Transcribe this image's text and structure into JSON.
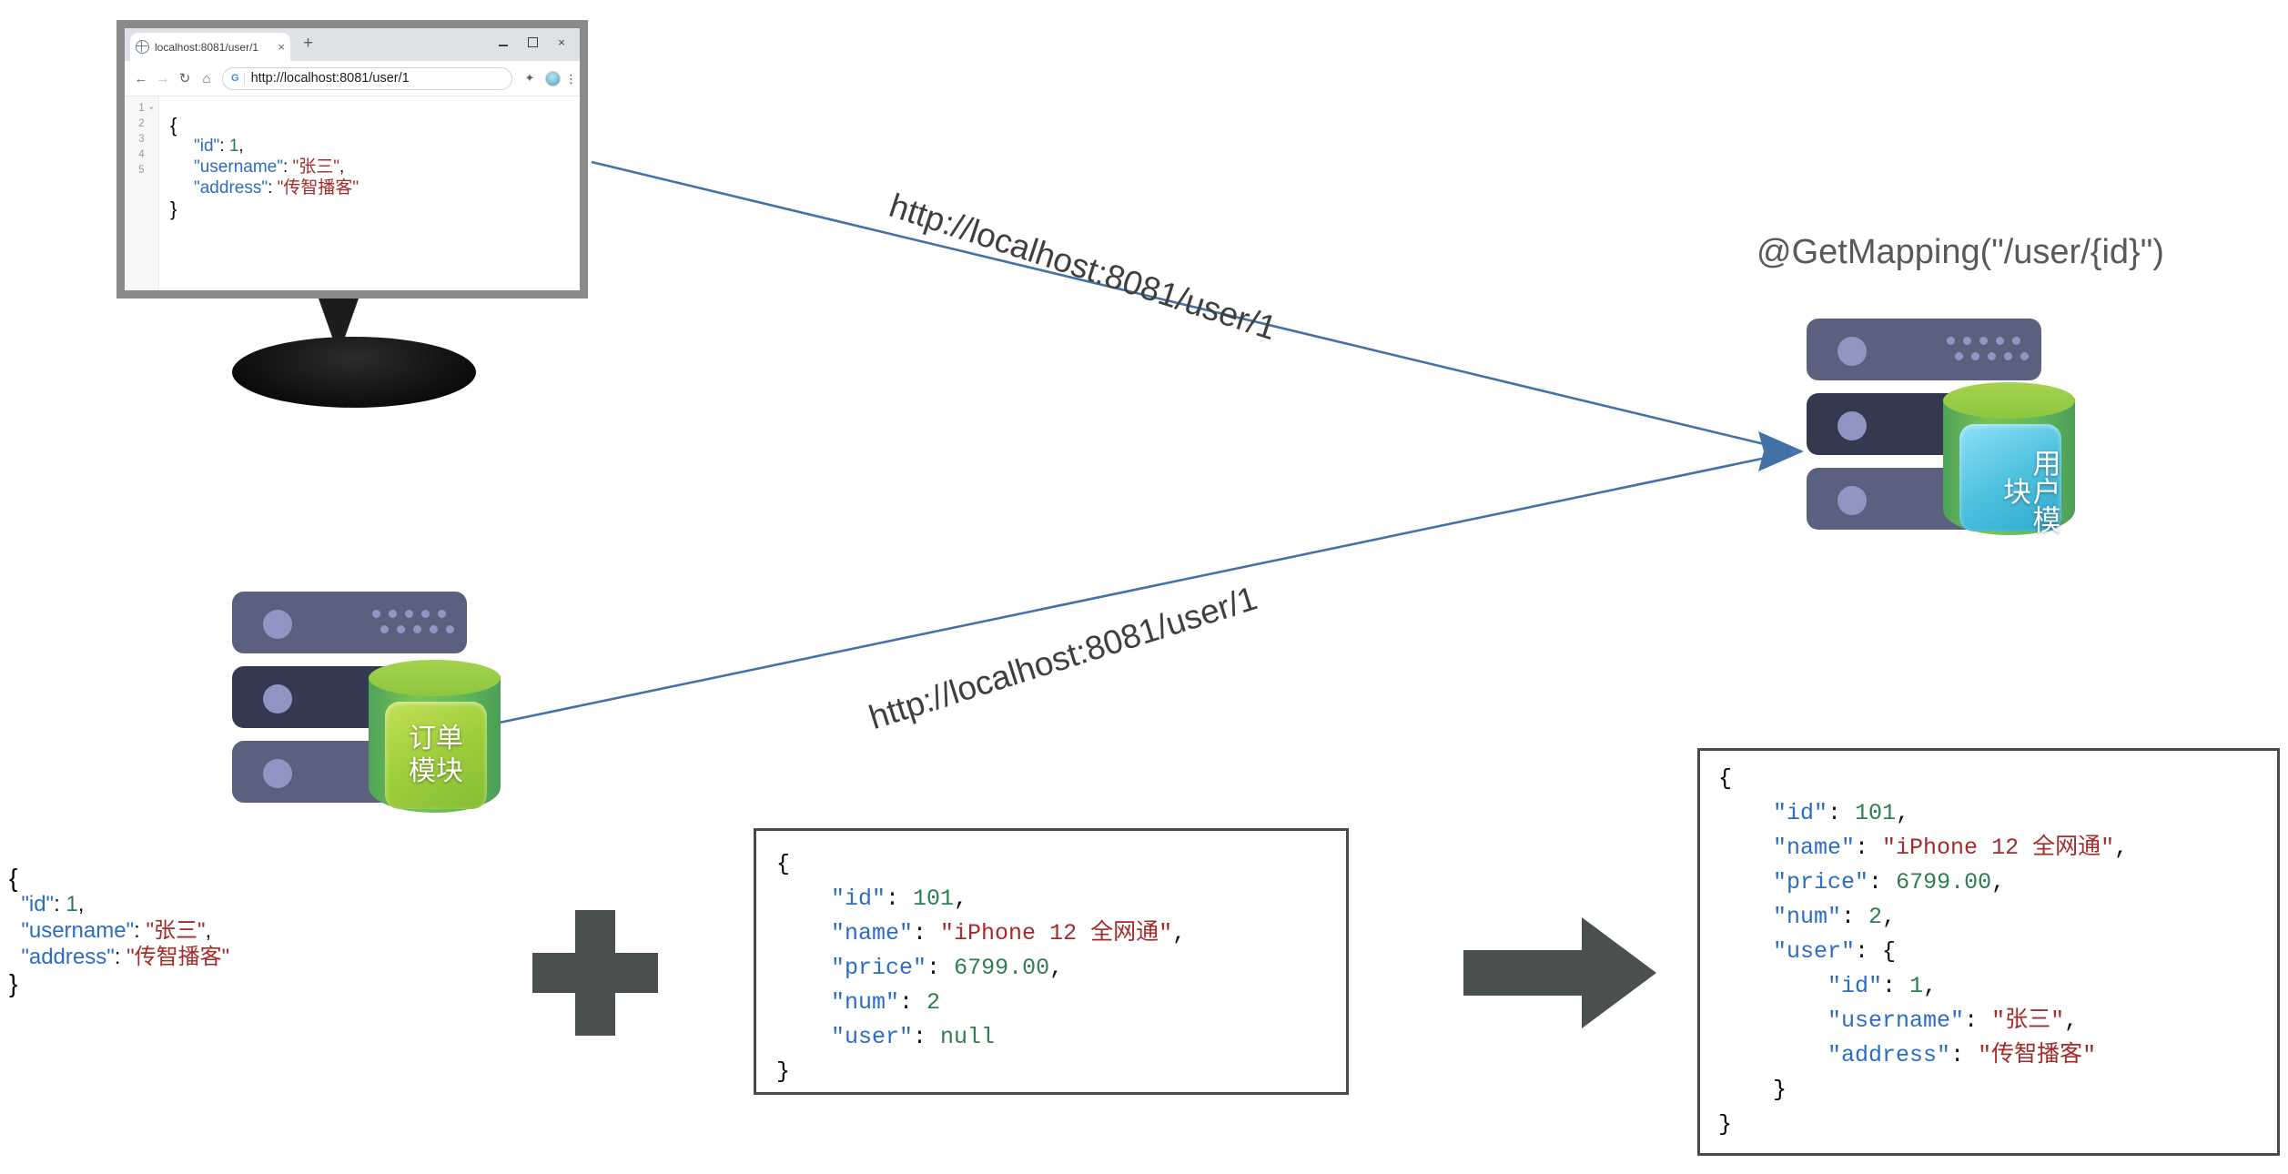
{
  "browser": {
    "tab_title": "localhost:8081/user/1",
    "tab_close": "×",
    "new_tab": "+",
    "window_minimize": "",
    "window_maximize": "",
    "window_close": "×",
    "nav_back": "←",
    "nav_forward": "→",
    "nav_reload": "↻",
    "nav_home": "⌂",
    "search_engine_icon": "G",
    "url": "http://localhost:8081/user/1",
    "extensions_icon": "✦",
    "menu_icon": "⋮",
    "gutter_lines": [
      "1",
      "2",
      "3",
      "4",
      "5"
    ],
    "gutter_caret": "▾",
    "response": {
      "open_brace": "{",
      "close_brace": "}",
      "rows": [
        {
          "key": "\"id\"",
          "sep": ": ",
          "value": "1",
          "type": "num",
          "comma": ","
        },
        {
          "key": "\"username\"",
          "sep": ": ",
          "value": "\"张三\"",
          "type": "str",
          "comma": ","
        },
        {
          "key": "\"address\"",
          "sep": ": ",
          "value": "\"传智播客\"",
          "type": "str",
          "comma": ""
        }
      ]
    }
  },
  "servers": {
    "order": {
      "label_lines": [
        "订单",
        "模块"
      ],
      "name": "order-module"
    },
    "user": {
      "label_lines": [
        "用户模块"
      ],
      "name": "user-module"
    }
  },
  "labels": {
    "url_top": "http://localhost:8081/user/1",
    "url_bottom": "http://localhost:8081/user/1",
    "get_mapping": "@GetMapping(\"/user/{id}\")"
  },
  "json_left": {
    "open": "{",
    "close": "}",
    "rows": [
      {
        "key": "\"id\"",
        "sep": ": ",
        "value": "1",
        "type": "num",
        "comma": ","
      },
      {
        "key": "\"username\"",
        "sep": ": ",
        "value": "\"张三\"",
        "type": "str",
        "comma": ","
      },
      {
        "key": "\"address\"",
        "sep": ": ",
        "value": "\"传智播客\"",
        "type": "str",
        "comma": ""
      }
    ]
  },
  "json_mid": {
    "open": "{",
    "close": "}",
    "rows": [
      {
        "key": "\"id\"",
        "sep": ": ",
        "value": "101",
        "type": "num",
        "comma": ","
      },
      {
        "key": "\"name\"",
        "sep": ": ",
        "value": "\"iPhone 12 全网通\"",
        "type": "str",
        "comma": ","
      },
      {
        "key": "\"price\"",
        "sep": ": ",
        "value": "6799.00",
        "type": "num",
        "comma": ","
      },
      {
        "key": "\"num\"",
        "sep": ": ",
        "value": "2",
        "type": "num",
        "comma": ""
      },
      {
        "key": "\"user\"",
        "sep": ": ",
        "value": "null",
        "type": "num",
        "comma": ""
      }
    ]
  },
  "json_right": {
    "open": "{",
    "close": "}",
    "rows": [
      {
        "key": "\"id\"",
        "sep": ": ",
        "value": "101",
        "type": "num",
        "comma": ",",
        "indent": 1
      },
      {
        "key": "\"name\"",
        "sep": ": ",
        "value": "\"iPhone 12 全网通\"",
        "type": "str",
        "comma": ",",
        "indent": 1
      },
      {
        "key": "\"price\"",
        "sep": ": ",
        "value": "6799.00",
        "type": "num",
        "comma": ",",
        "indent": 1
      },
      {
        "key": "\"num\"",
        "sep": ": ",
        "value": "2",
        "type": "num",
        "comma": ",",
        "indent": 1
      },
      {
        "key": "\"user\"",
        "sep": ": ",
        "value": "{",
        "type": "plain",
        "comma": "",
        "indent": 1
      },
      {
        "key": "\"id\"",
        "sep": ": ",
        "value": "1",
        "type": "num",
        "comma": ",",
        "indent": 2
      },
      {
        "key": "\"username\"",
        "sep": ": ",
        "value": "\"张三\"",
        "type": "str",
        "comma": ",",
        "indent": 2
      },
      {
        "key": "\"address\"",
        "sep": ": ",
        "value": "\"传智播客\"",
        "type": "str",
        "comma": "",
        "indent": 2
      }
    ],
    "inner_close": "}"
  },
  "glyphs": {
    "plus": "+",
    "result_arrow": "→"
  },
  "colors": {
    "json_key": "#2b6cc4",
    "json_string": "#a52a2a",
    "json_number": "#2e7d4f",
    "connector": "#4472a8",
    "glyph_gray": "#4a4f4f",
    "server_rack": "#5a617e",
    "server_rack_dark": "#333a4f",
    "cylinder_green": "#8cc63f",
    "cylinder_blue": "#4fc2e0"
  }
}
